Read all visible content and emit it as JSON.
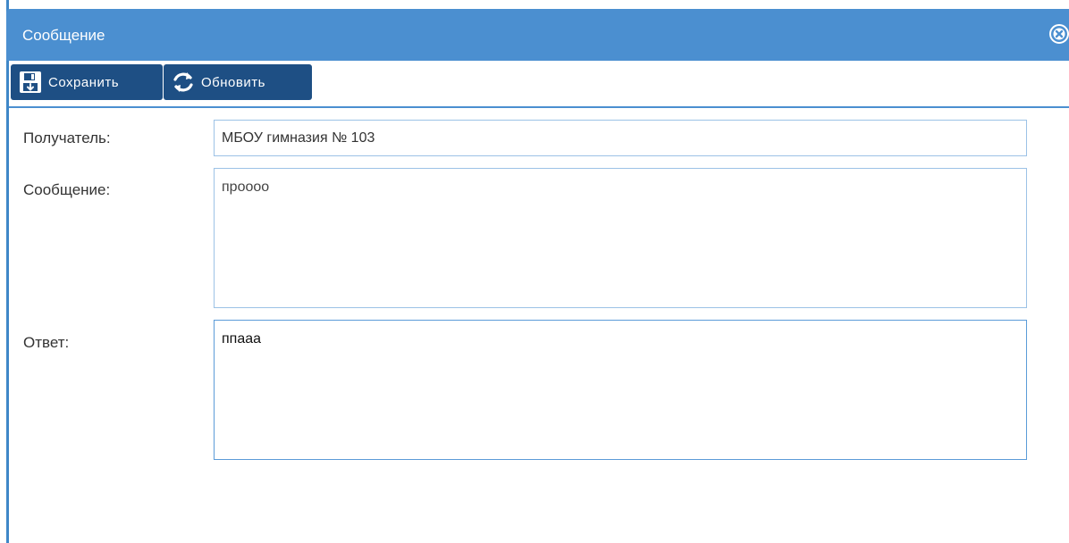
{
  "window": {
    "title": "Сообщение"
  },
  "toolbar": {
    "save_label": "Сохранить",
    "refresh_label": "Обновить"
  },
  "form": {
    "recipient_label": "Получатель:",
    "recipient_value": "МБОУ гимназия № 103",
    "message_label": "Сообщение:",
    "message_value": "проооо",
    "answer_label": "Ответ:",
    "answer_value": "ппааа"
  },
  "colors": {
    "titlebar": "#4b8fd0",
    "button": "#1e4f84",
    "field_border": "#9cc2e6"
  },
  "icons": {
    "save": "floppy-disk-icon",
    "refresh": "refresh-icon",
    "close": "close-icon"
  }
}
